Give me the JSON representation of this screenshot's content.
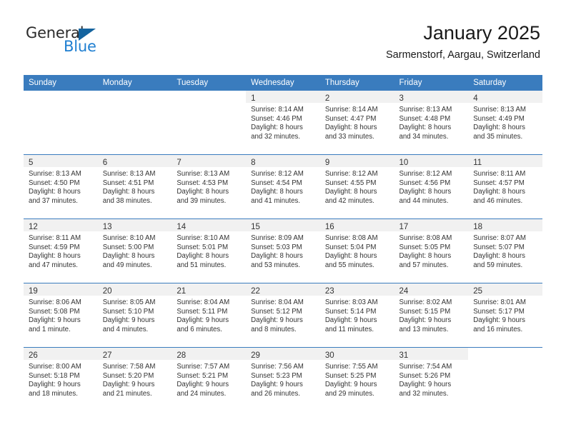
{
  "logo": {
    "word1": "General",
    "word2": "Blue",
    "triangle_color": "#14639e",
    "blue_color": "#1f7fd1"
  },
  "header": {
    "title": "January 2025",
    "subtitle": "Sarmenstorf, Aargau, Switzerland"
  },
  "theme": {
    "header_blue": "#3a7cbe",
    "daynum_band": "#f1f1f1",
    "text": "#333333"
  },
  "weekdays": [
    "Sunday",
    "Monday",
    "Tuesday",
    "Wednesday",
    "Thursday",
    "Friday",
    "Saturday"
  ],
  "weeks": [
    [
      {
        "day": "",
        "sunrise": "",
        "sunset": "",
        "daylight1": "",
        "daylight2": ""
      },
      {
        "day": "",
        "sunrise": "",
        "sunset": "",
        "daylight1": "",
        "daylight2": ""
      },
      {
        "day": "",
        "sunrise": "",
        "sunset": "",
        "daylight1": "",
        "daylight2": ""
      },
      {
        "day": "1",
        "sunrise": "Sunrise: 8:14 AM",
        "sunset": "Sunset: 4:46 PM",
        "daylight1": "Daylight: 8 hours",
        "daylight2": "and 32 minutes."
      },
      {
        "day": "2",
        "sunrise": "Sunrise: 8:14 AM",
        "sunset": "Sunset: 4:47 PM",
        "daylight1": "Daylight: 8 hours",
        "daylight2": "and 33 minutes."
      },
      {
        "day": "3",
        "sunrise": "Sunrise: 8:13 AM",
        "sunset": "Sunset: 4:48 PM",
        "daylight1": "Daylight: 8 hours",
        "daylight2": "and 34 minutes."
      },
      {
        "day": "4",
        "sunrise": "Sunrise: 8:13 AM",
        "sunset": "Sunset: 4:49 PM",
        "daylight1": "Daylight: 8 hours",
        "daylight2": "and 35 minutes."
      }
    ],
    [
      {
        "day": "5",
        "sunrise": "Sunrise: 8:13 AM",
        "sunset": "Sunset: 4:50 PM",
        "daylight1": "Daylight: 8 hours",
        "daylight2": "and 37 minutes."
      },
      {
        "day": "6",
        "sunrise": "Sunrise: 8:13 AM",
        "sunset": "Sunset: 4:51 PM",
        "daylight1": "Daylight: 8 hours",
        "daylight2": "and 38 minutes."
      },
      {
        "day": "7",
        "sunrise": "Sunrise: 8:13 AM",
        "sunset": "Sunset: 4:53 PM",
        "daylight1": "Daylight: 8 hours",
        "daylight2": "and 39 minutes."
      },
      {
        "day": "8",
        "sunrise": "Sunrise: 8:12 AM",
        "sunset": "Sunset: 4:54 PM",
        "daylight1": "Daylight: 8 hours",
        "daylight2": "and 41 minutes."
      },
      {
        "day": "9",
        "sunrise": "Sunrise: 8:12 AM",
        "sunset": "Sunset: 4:55 PM",
        "daylight1": "Daylight: 8 hours",
        "daylight2": "and 42 minutes."
      },
      {
        "day": "10",
        "sunrise": "Sunrise: 8:12 AM",
        "sunset": "Sunset: 4:56 PM",
        "daylight1": "Daylight: 8 hours",
        "daylight2": "and 44 minutes."
      },
      {
        "day": "11",
        "sunrise": "Sunrise: 8:11 AM",
        "sunset": "Sunset: 4:57 PM",
        "daylight1": "Daylight: 8 hours",
        "daylight2": "and 46 minutes."
      }
    ],
    [
      {
        "day": "12",
        "sunrise": "Sunrise: 8:11 AM",
        "sunset": "Sunset: 4:59 PM",
        "daylight1": "Daylight: 8 hours",
        "daylight2": "and 47 minutes."
      },
      {
        "day": "13",
        "sunrise": "Sunrise: 8:10 AM",
        "sunset": "Sunset: 5:00 PM",
        "daylight1": "Daylight: 8 hours",
        "daylight2": "and 49 minutes."
      },
      {
        "day": "14",
        "sunrise": "Sunrise: 8:10 AM",
        "sunset": "Sunset: 5:01 PM",
        "daylight1": "Daylight: 8 hours",
        "daylight2": "and 51 minutes."
      },
      {
        "day": "15",
        "sunrise": "Sunrise: 8:09 AM",
        "sunset": "Sunset: 5:03 PM",
        "daylight1": "Daylight: 8 hours",
        "daylight2": "and 53 minutes."
      },
      {
        "day": "16",
        "sunrise": "Sunrise: 8:08 AM",
        "sunset": "Sunset: 5:04 PM",
        "daylight1": "Daylight: 8 hours",
        "daylight2": "and 55 minutes."
      },
      {
        "day": "17",
        "sunrise": "Sunrise: 8:08 AM",
        "sunset": "Sunset: 5:05 PM",
        "daylight1": "Daylight: 8 hours",
        "daylight2": "and 57 minutes."
      },
      {
        "day": "18",
        "sunrise": "Sunrise: 8:07 AM",
        "sunset": "Sunset: 5:07 PM",
        "daylight1": "Daylight: 8 hours",
        "daylight2": "and 59 minutes."
      }
    ],
    [
      {
        "day": "19",
        "sunrise": "Sunrise: 8:06 AM",
        "sunset": "Sunset: 5:08 PM",
        "daylight1": "Daylight: 9 hours",
        "daylight2": "and 1 minute."
      },
      {
        "day": "20",
        "sunrise": "Sunrise: 8:05 AM",
        "sunset": "Sunset: 5:10 PM",
        "daylight1": "Daylight: 9 hours",
        "daylight2": "and 4 minutes."
      },
      {
        "day": "21",
        "sunrise": "Sunrise: 8:04 AM",
        "sunset": "Sunset: 5:11 PM",
        "daylight1": "Daylight: 9 hours",
        "daylight2": "and 6 minutes."
      },
      {
        "day": "22",
        "sunrise": "Sunrise: 8:04 AM",
        "sunset": "Sunset: 5:12 PM",
        "daylight1": "Daylight: 9 hours",
        "daylight2": "and 8 minutes."
      },
      {
        "day": "23",
        "sunrise": "Sunrise: 8:03 AM",
        "sunset": "Sunset: 5:14 PM",
        "daylight1": "Daylight: 9 hours",
        "daylight2": "and 11 minutes."
      },
      {
        "day": "24",
        "sunrise": "Sunrise: 8:02 AM",
        "sunset": "Sunset: 5:15 PM",
        "daylight1": "Daylight: 9 hours",
        "daylight2": "and 13 minutes."
      },
      {
        "day": "25",
        "sunrise": "Sunrise: 8:01 AM",
        "sunset": "Sunset: 5:17 PM",
        "daylight1": "Daylight: 9 hours",
        "daylight2": "and 16 minutes."
      }
    ],
    [
      {
        "day": "26",
        "sunrise": "Sunrise: 8:00 AM",
        "sunset": "Sunset: 5:18 PM",
        "daylight1": "Daylight: 9 hours",
        "daylight2": "and 18 minutes."
      },
      {
        "day": "27",
        "sunrise": "Sunrise: 7:58 AM",
        "sunset": "Sunset: 5:20 PM",
        "daylight1": "Daylight: 9 hours",
        "daylight2": "and 21 minutes."
      },
      {
        "day": "28",
        "sunrise": "Sunrise: 7:57 AM",
        "sunset": "Sunset: 5:21 PM",
        "daylight1": "Daylight: 9 hours",
        "daylight2": "and 24 minutes."
      },
      {
        "day": "29",
        "sunrise": "Sunrise: 7:56 AM",
        "sunset": "Sunset: 5:23 PM",
        "daylight1": "Daylight: 9 hours",
        "daylight2": "and 26 minutes."
      },
      {
        "day": "30",
        "sunrise": "Sunrise: 7:55 AM",
        "sunset": "Sunset: 5:25 PM",
        "daylight1": "Daylight: 9 hours",
        "daylight2": "and 29 minutes."
      },
      {
        "day": "31",
        "sunrise": "Sunrise: 7:54 AM",
        "sunset": "Sunset: 5:26 PM",
        "daylight1": "Daylight: 9 hours",
        "daylight2": "and 32 minutes."
      },
      {
        "day": "",
        "sunrise": "",
        "sunset": "",
        "daylight1": "",
        "daylight2": ""
      }
    ]
  ]
}
